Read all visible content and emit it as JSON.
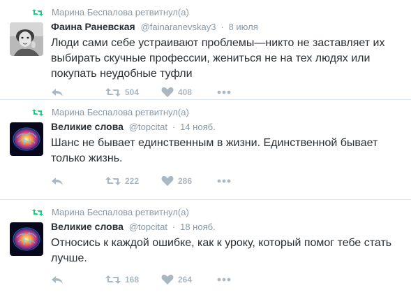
{
  "tweets": [
    {
      "retweet_by": "Марина Беспалова ретвитнул(а)",
      "name": "Фаина Раневская",
      "handle": "@fainaranevskay3",
      "time": "8 июля",
      "text": "Люди сами себе устраивают проблемы—никто не заставляет их выбирать скучные профессии, жениться не на тех людях или покупать неудобные туфли",
      "retweets": "504",
      "likes": "408",
      "avatar": "portrait-photo"
    },
    {
      "retweet_by": "Марина Беспалова ретвитнул(а)",
      "name": "Великие слова",
      "handle": "@topcitat",
      "time": "14 нояб.",
      "text": "Шанс не бывает единственным в жизни. Единственной бывает только жизнь.",
      "retweets": "222",
      "likes": "286",
      "avatar": "glowing-brain"
    },
    {
      "retweet_by": "Марина Беспалова ретвитнул(а)",
      "name": "Великие слова",
      "handle": "@topcitat",
      "time": "18 нояб.",
      "text": "Относись к каждой ошибке, как к уроку, который помог тебе стать лучше.",
      "retweets": "168",
      "likes": "264",
      "avatar": "glowing-brain"
    }
  ],
  "colors": {
    "text": "#292f33",
    "muted": "#8899a6",
    "retweet_green": "#19cf86",
    "action_gray": "#aab8c2",
    "divider": "#e1e8ed"
  },
  "icons": {
    "retweeted": "retweet-icon",
    "reply": "reply-icon",
    "retweet": "retweet-icon",
    "like": "heart-icon",
    "more": "more-dots-icon"
  }
}
